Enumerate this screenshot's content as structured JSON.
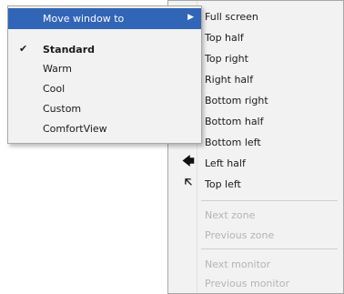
{
  "left_menu": {
    "items": [
      {
        "label": "Move window to",
        "highlighted": true,
        "submenu_arrow": "▶"
      },
      {
        "label": "Standard",
        "checked": true,
        "check_glyph": "✔",
        "bold": true
      },
      {
        "label": "Warm"
      },
      {
        "label": "Cool"
      },
      {
        "label": "Custom"
      },
      {
        "label": "ComfortView"
      }
    ]
  },
  "right_menu": {
    "items": [
      {
        "label": "Full screen",
        "icon": "fullscreen-icon"
      },
      {
        "label": "Top half",
        "icon": "arrow-up-icon",
        "glyph": "🡅"
      },
      {
        "label": "Top right",
        "icon": "arrow-up-right-icon",
        "glyph": "🡥"
      },
      {
        "label": "Right half",
        "icon": "arrow-right-icon",
        "glyph": "🡆"
      },
      {
        "label": "Bottom right",
        "icon": "arrow-down-right-icon",
        "glyph": "🡦"
      },
      {
        "label": "Bottom half",
        "icon": "arrow-down-icon",
        "glyph": "🡇"
      },
      {
        "label": "Bottom left",
        "icon": "arrow-down-left-icon",
        "glyph": "🡧"
      },
      {
        "label": "Left half",
        "icon": "arrow-left-icon",
        "glyph": "🡄"
      },
      {
        "label": "Top left",
        "icon": "arrow-up-left-icon",
        "glyph": "🡤"
      }
    ],
    "disabled_group_1": [
      "Next zone",
      "Previous zone"
    ],
    "disabled_group_2": [
      "Next monitor",
      "Previous monitor"
    ]
  },
  "colors": {
    "highlight": "#3165b8",
    "menu_bg": "#f2f2f2",
    "disabled_text": "#b4b4b4"
  }
}
